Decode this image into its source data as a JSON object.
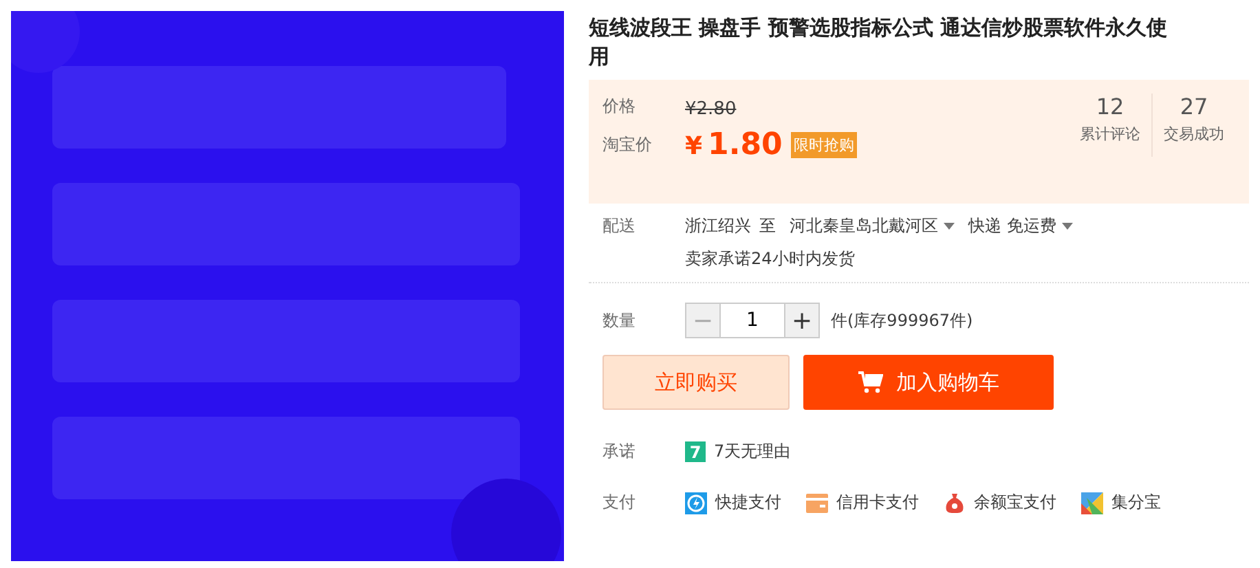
{
  "title": "短线波段王 操盘手 预警选股指标公式 通达信炒股票软件永久使用",
  "price": {
    "label": "价格",
    "original": "¥2.80",
    "promo_label": "淘宝价",
    "currency": "¥",
    "promo": "1.80",
    "badge": "限时抢购"
  },
  "stats": [
    {
      "value": "12",
      "label": "累计评论"
    },
    {
      "value": "27",
      "label": "交易成功"
    }
  ],
  "delivery": {
    "label": "配送",
    "from": "浙江绍兴",
    "to_word": "至",
    "to": "河北秦皇岛北戴河区",
    "method": "快递 免运费",
    "promise": "卖家承诺24小时内发货"
  },
  "quantity": {
    "label": "数量",
    "minus": "−",
    "value": "1",
    "plus": "+",
    "stock": "件(库存999967件)"
  },
  "buttons": [
    {
      "kind": "buy",
      "label": "立即购买"
    },
    {
      "kind": "cart",
      "label": "加入购物车"
    }
  ],
  "promise": {
    "label": "承诺",
    "icon_text": "7",
    "text": "7天无理由"
  },
  "payment": {
    "label": "支付",
    "methods": [
      {
        "kind": "quick",
        "label": "快捷支付"
      },
      {
        "kind": "card",
        "label": "信用卡支付"
      },
      {
        "kind": "yuebao",
        "label": "余额宝支付"
      },
      {
        "kind": "points",
        "label": "集分宝"
      }
    ]
  }
}
